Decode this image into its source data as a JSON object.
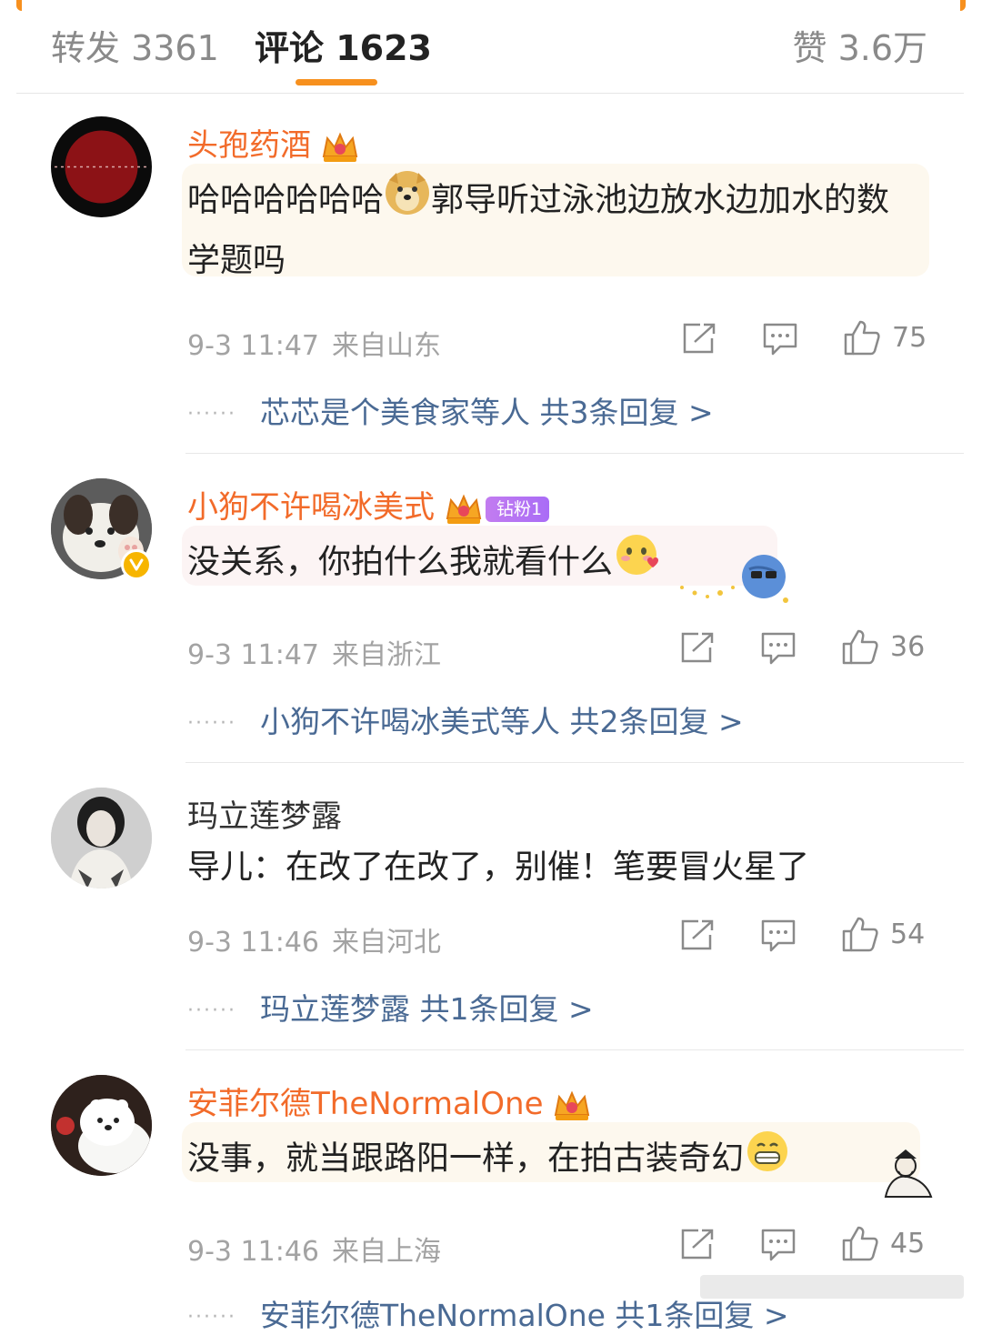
{
  "header": {
    "repost_tab": "转发 3361",
    "comments_tab": "评论 1623",
    "likes_tab": "赞 3.6万",
    "accent_color": "#f7901e"
  },
  "comments": [
    {
      "username": "头孢药酒",
      "crown_icon": "crown-icon",
      "text_before": "哈哈哈哈哈哈",
      "emoji": "doge-emoji",
      "text_after": "郭导听过泳池边放水边加水的数学题吗",
      "time": "9-3 11:47",
      "location": "来自山东",
      "likes": "75",
      "reply_summary": "芯芯是个美食家等人  共3条回复 >"
    },
    {
      "username": "小狗不许喝冰美式",
      "crown_icon": "crown-icon",
      "fan_badge": "钻粉1",
      "text": "没关系，你拍什么我就看什么",
      "emoji": "blush-heart-emoji",
      "time": "9-3 11:47",
      "location": "来自浙江",
      "likes": "36",
      "reply_summary": "小狗不许喝冰美式等人  共2条回复 >"
    },
    {
      "username": "玛立莲梦露",
      "text": "导儿：在改了在改了，别催！笔要冒火星了",
      "time": "9-3 11:46",
      "location": "来自河北",
      "likes": "54",
      "reply_summary": "玛立莲梦露  共1条回复 >"
    },
    {
      "username": "安菲尔德TheNormalOne",
      "crown_icon": "crown-icon",
      "text": "没事，就当跟路阳一样，在拍古装奇幻",
      "emoji": "grin-emoji",
      "time": "9-3 11:46",
      "location": "来自上海",
      "likes": "45",
      "reply_summary": "安菲尔德TheNormalOne  共1条回复 >"
    }
  ],
  "colors": {
    "vip_name": "#f26b2a",
    "reply_link": "#4a6a94",
    "meta_gray": "#a3a3a3"
  }
}
